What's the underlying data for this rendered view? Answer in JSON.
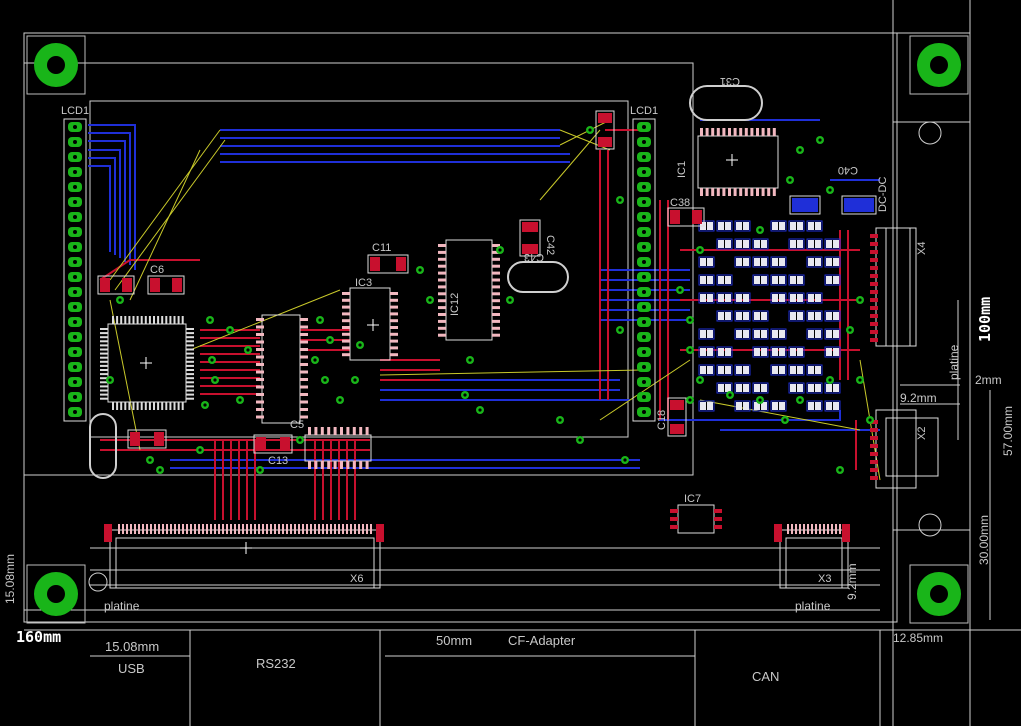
{
  "board": {
    "dimensions": {
      "width_label": "160mm",
      "height_label": "100mm",
      "left_offset_label": "15.08mm",
      "right_offset_label": "12.85mm",
      "x4_dim_1": "2mm",
      "x4_dim_2": "9.2mm",
      "x2_dim_1": "57.00mm",
      "x2_dim_2": "30.00mm",
      "x3_dim": "9.2mm"
    },
    "labels": {
      "lcd_left": "LCD1",
      "lcd_right": "LCD1",
      "platine_left": "platine",
      "platine_right": "platine",
      "platine_vertical": "platine",
      "dc_dc": "DC-DC",
      "x6": "X6",
      "x3": "X3",
      "x4": "X4",
      "x2": "X2",
      "ic1": "IC1",
      "ic3": "IC3",
      "ic7": "IC7",
      "ic12": "IC12",
      "c11": "C11",
      "c6": "C6",
      "c31": "C31",
      "c42": "C42",
      "c43": "C43",
      "c40": "C40",
      "c38": "C38",
      "c5": "C5",
      "c13": "C13",
      "c18": "C18"
    },
    "footer": {
      "usb_dim": "15.08mm",
      "usb": "USB",
      "rs232": "RS232",
      "cf_dim": "50mm",
      "cf": "CF-Adapter",
      "can": "CAN"
    }
  }
}
